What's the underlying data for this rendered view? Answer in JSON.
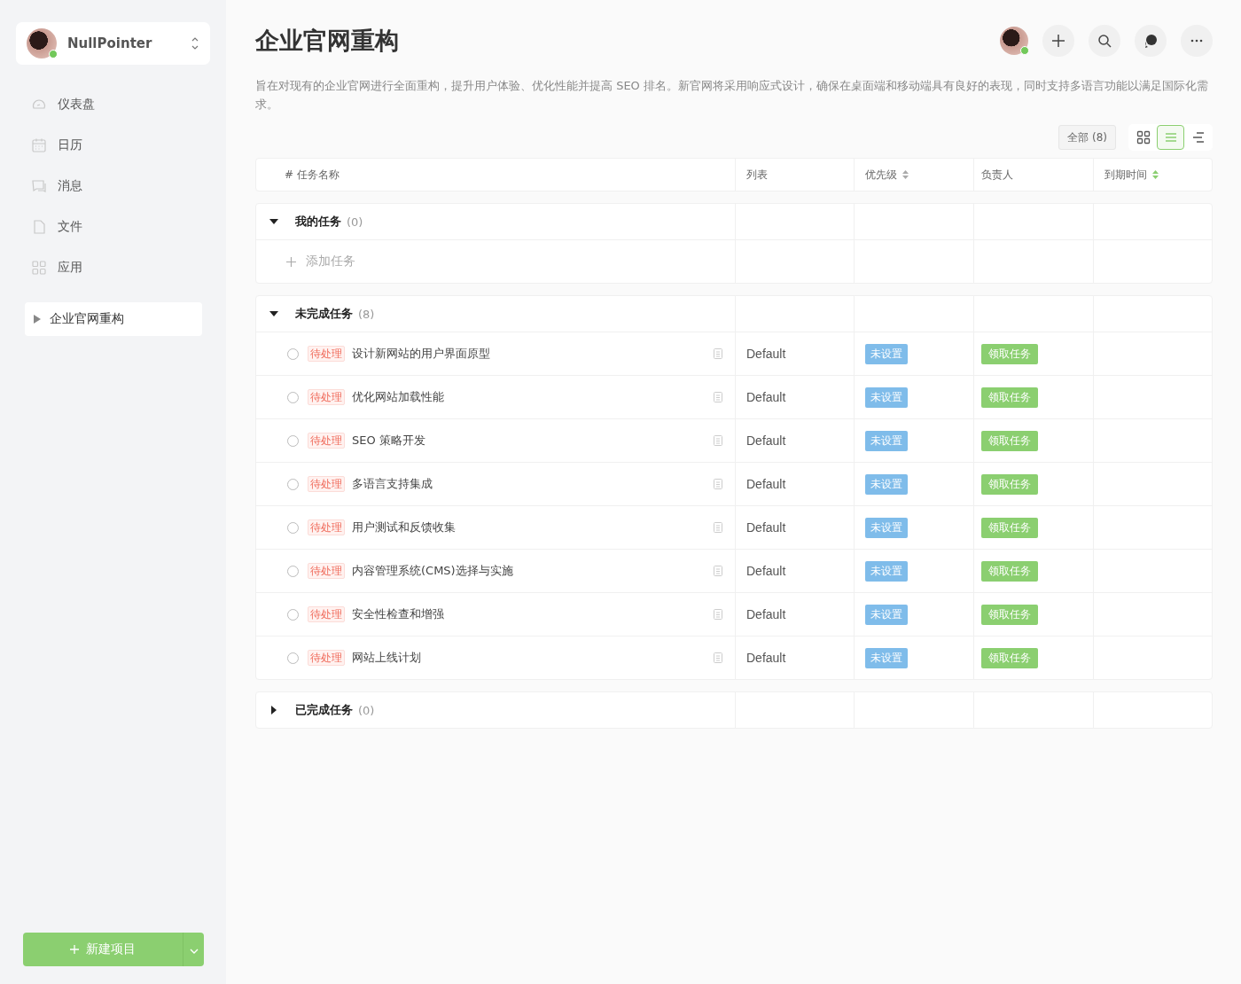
{
  "sidebar": {
    "user": {
      "name": "NullPointer",
      "online": true
    },
    "nav": [
      {
        "kind": "dashboard",
        "label": "仪表盘"
      },
      {
        "kind": "calendar",
        "label": "日历"
      },
      {
        "kind": "message",
        "label": "消息"
      },
      {
        "kind": "file",
        "label": "文件"
      },
      {
        "kind": "apps",
        "label": "应用"
      }
    ],
    "projects": [
      {
        "label": "企业官网重构",
        "selected": true
      }
    ],
    "new_project_button": "新建项目"
  },
  "header": {
    "title": "企业官网重构",
    "online": true,
    "description": "旨在对现有的企业官网进行全面重构，提升用户体验、优化性能并提高 SEO 排名。新官网将采用响应式设计，确保在桌面端和移动端具有良好的表现，同时支持多语言功能以满足国际化需求。",
    "filter": "全部 (8)",
    "views": [
      {
        "kind": "grid",
        "selected": false
      },
      {
        "kind": "list",
        "selected": true
      },
      {
        "kind": "gantt",
        "selected": false
      }
    ]
  },
  "table": {
    "columns": [
      {
        "label": "# 任务名称",
        "sortable": false
      },
      {
        "label": "列表",
        "sortable": false
      },
      {
        "label": "优先级",
        "sortable": true,
        "sorted": false
      },
      {
        "label": "负责人",
        "sortable": false
      },
      {
        "label": "到期时间",
        "sortable": true,
        "sorted": true
      }
    ],
    "groups": [
      {
        "title": "我的任务",
        "count": "(0)",
        "expanded": true,
        "add_task": "添加任务"
      },
      {
        "title": "未完成任务",
        "count": "(8)",
        "expanded": true,
        "tasks": [
          {
            "status": "待处理",
            "name": "设计新网站的用户界面原型",
            "list": "Default",
            "priority": "未设置",
            "action": "领取任务",
            "done": false
          },
          {
            "status": "待处理",
            "name": "优化网站加载性能",
            "list": "Default",
            "priority": "未设置",
            "action": "领取任务",
            "done": false
          },
          {
            "status": "待处理",
            "name": "SEO 策略开发",
            "list": "Default",
            "priority": "未设置",
            "action": "领取任务",
            "done": false
          },
          {
            "status": "待处理",
            "name": "多语言支持集成",
            "list": "Default",
            "priority": "未设置",
            "action": "领取任务",
            "done": false
          },
          {
            "status": "待处理",
            "name": "用户测试和反馈收集",
            "list": "Default",
            "priority": "未设置",
            "action": "领取任务",
            "done": false
          },
          {
            "status": "待处理",
            "name": "内容管理系统(CMS)选择与实施",
            "list": "Default",
            "priority": "未设置",
            "action": "领取任务",
            "done": false
          },
          {
            "status": "待处理",
            "name": "安全性检查和增强",
            "list": "Default",
            "priority": "未设置",
            "action": "领取任务",
            "done": false
          },
          {
            "status": "待处理",
            "name": "网站上线计划",
            "list": "Default",
            "priority": "未设置",
            "action": "领取任务",
            "done": false
          }
        ]
      },
      {
        "title": "已完成任务",
        "count": "(0)",
        "expanded": false
      }
    ]
  }
}
